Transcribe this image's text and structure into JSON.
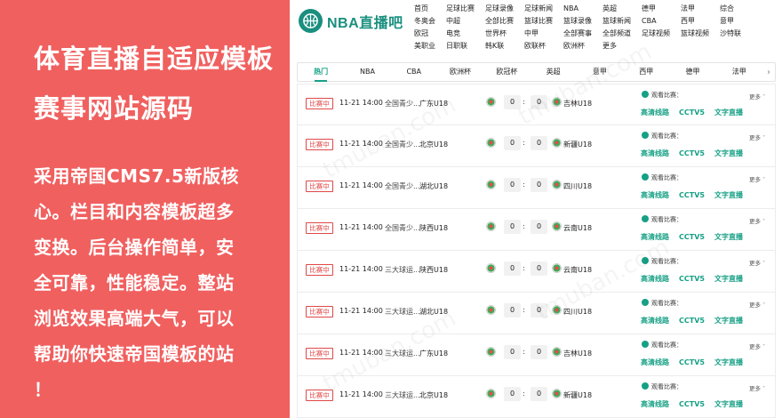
{
  "promo": {
    "title_lines": [
      "体育直播自适应模板",
      "赛事网站源码"
    ],
    "desc_lines": [
      "采用帝国CMS7.5新版核",
      "心。栏目和内容模板超多",
      "变换。后台操作简单，安",
      "全可靠，性能稳定。整站",
      "浏览效果高端大气，可以",
      "帮助你快速帝国模板的站",
      "！"
    ]
  },
  "logo": {
    "text": "NBA直播吧",
    "icon": "basketball-icon"
  },
  "nav": [
    "首页",
    "足球比赛",
    "足球录像",
    "足球新闻",
    "NBA",
    "英超",
    "德甲",
    "法甲",
    "综合",
    "冬奥会",
    "中超",
    "全部比赛",
    "篮球比赛",
    "篮球录像",
    "篮球新闻",
    "CBA",
    "西甲",
    "意甲",
    "欧冠",
    "电竞",
    "世界杯",
    "中甲",
    "全部赛事",
    "全部频道",
    "足球视频",
    "篮球视频",
    "沙特联",
    "美职业",
    "日职联",
    "韩K联",
    "欧联杯",
    "欧洲杯",
    "更多"
  ],
  "tabs": [
    "热门",
    "NBA",
    "CBA",
    "欧洲杯",
    "欧冠杯",
    "英超",
    "意甲",
    "西甲",
    "德甲",
    "法甲"
  ],
  "tab_next": "›",
  "row_labels": {
    "badge": "比赛中",
    "watch": "观看比赛：",
    "links": [
      "高清线路",
      "CCTV5",
      "文字直播"
    ],
    "more": "更多",
    "colon": ":"
  },
  "matches": [
    {
      "time": "11-21 14:00",
      "league": "全国青少...",
      "home": "广东U18",
      "home_score": "0",
      "away_score": "0",
      "away": "吉林U18"
    },
    {
      "time": "11-21 14:00",
      "league": "全国青少...",
      "home": "北京U18",
      "home_score": "0",
      "away_score": "0",
      "away": "新疆U18"
    },
    {
      "time": "11-21 14:00",
      "league": "全国青少...",
      "home": "湖北U18",
      "home_score": "0",
      "away_score": "0",
      "away": "四川U18"
    },
    {
      "time": "11-21 14:00",
      "league": "全国青少...",
      "home": "陕西U18",
      "home_score": "0",
      "away_score": "0",
      "away": "云南U18"
    },
    {
      "time": "11-21 14:00",
      "league": "三大球运...",
      "home": "陕西U18",
      "home_score": "0",
      "away_score": "0",
      "away": "云南U18"
    },
    {
      "time": "11-21 14:00",
      "league": "三大球运...",
      "home": "湖北U18",
      "home_score": "0",
      "away_score": "0",
      "away": "四川U18"
    },
    {
      "time": "11-21 14:00",
      "league": "三大球运...",
      "home": "广东U18",
      "home_score": "0",
      "away_score": "0",
      "away": "吉林U18"
    },
    {
      "time": "11-21 14:00",
      "league": "三大球运...",
      "home": "北京U18",
      "home_score": "0",
      "away_score": "0",
      "away": "新疆U18"
    }
  ],
  "watermark": "tmuban.com",
  "colors": {
    "accent": "#16a085",
    "promo_bg": "#f0605f",
    "live_red": "#e04848"
  }
}
